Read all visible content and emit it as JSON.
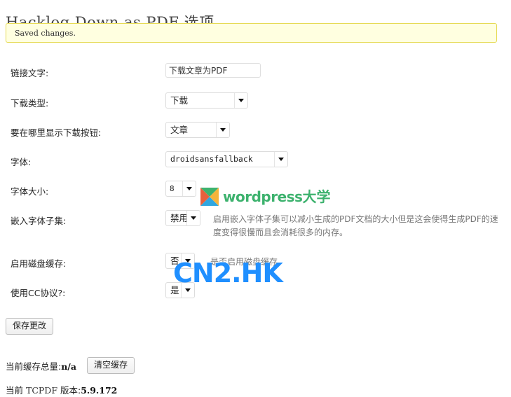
{
  "page": {
    "title": "Hacklog Down as PDF 选项",
    "notice": "Saved changes."
  },
  "form": {
    "rows": [
      {
        "label": "链接文字:",
        "control": "text",
        "value": "下载文章为PDF",
        "name": "link-text"
      },
      {
        "label": "下载类型:",
        "control": "select",
        "value": "下载",
        "name": "download-type"
      },
      {
        "label": "要在哪里显示下载按钮:",
        "control": "select",
        "value": "文章",
        "name": "display-location"
      },
      {
        "label": "字体:",
        "control": "select",
        "value": "droidsansfallback",
        "name": "font"
      },
      {
        "label": "字体大小:",
        "control": "select",
        "value": "8",
        "name": "font-size"
      },
      {
        "label": "嵌入字体子集:",
        "control": "select",
        "value": "禁用",
        "name": "embed-font-subset",
        "description": "启用嵌入字体子集可以减小生成的PDF文档的大小但是这会使得生成PDF的速度变得很慢而且会消耗很多的内存。"
      },
      {
        "label": "启用磁盘缓存:",
        "control": "select",
        "value": "否",
        "name": "enable-disk-cache",
        "description": "是否启用磁盘缓存。"
      },
      {
        "label": "使用CC协议?:",
        "control": "select",
        "value": "是",
        "name": "use-cc-license"
      }
    ]
  },
  "actions": {
    "save_label": "保存更改",
    "clear_cache_label": "清空缓存"
  },
  "footer": {
    "cache_total_label": "当前缓存总量:",
    "cache_total_value": "n/a",
    "tcpdf_label_prefix": "当前 ",
    "tcpdf_word": "TCPDF",
    "tcpdf_label_suffix": " 版本:",
    "tcpdf_version": "5.9.172"
  },
  "watermarks": {
    "wordpress_text": "wordpress",
    "wordpress_cn": "大学",
    "cn2hk": "CN2.HK"
  },
  "colors": {
    "notice_bg": "#ffffe0",
    "notice_border": "#e6db55",
    "watermark_green": "#3db26e",
    "watermark_blue": "#1f8fff"
  }
}
